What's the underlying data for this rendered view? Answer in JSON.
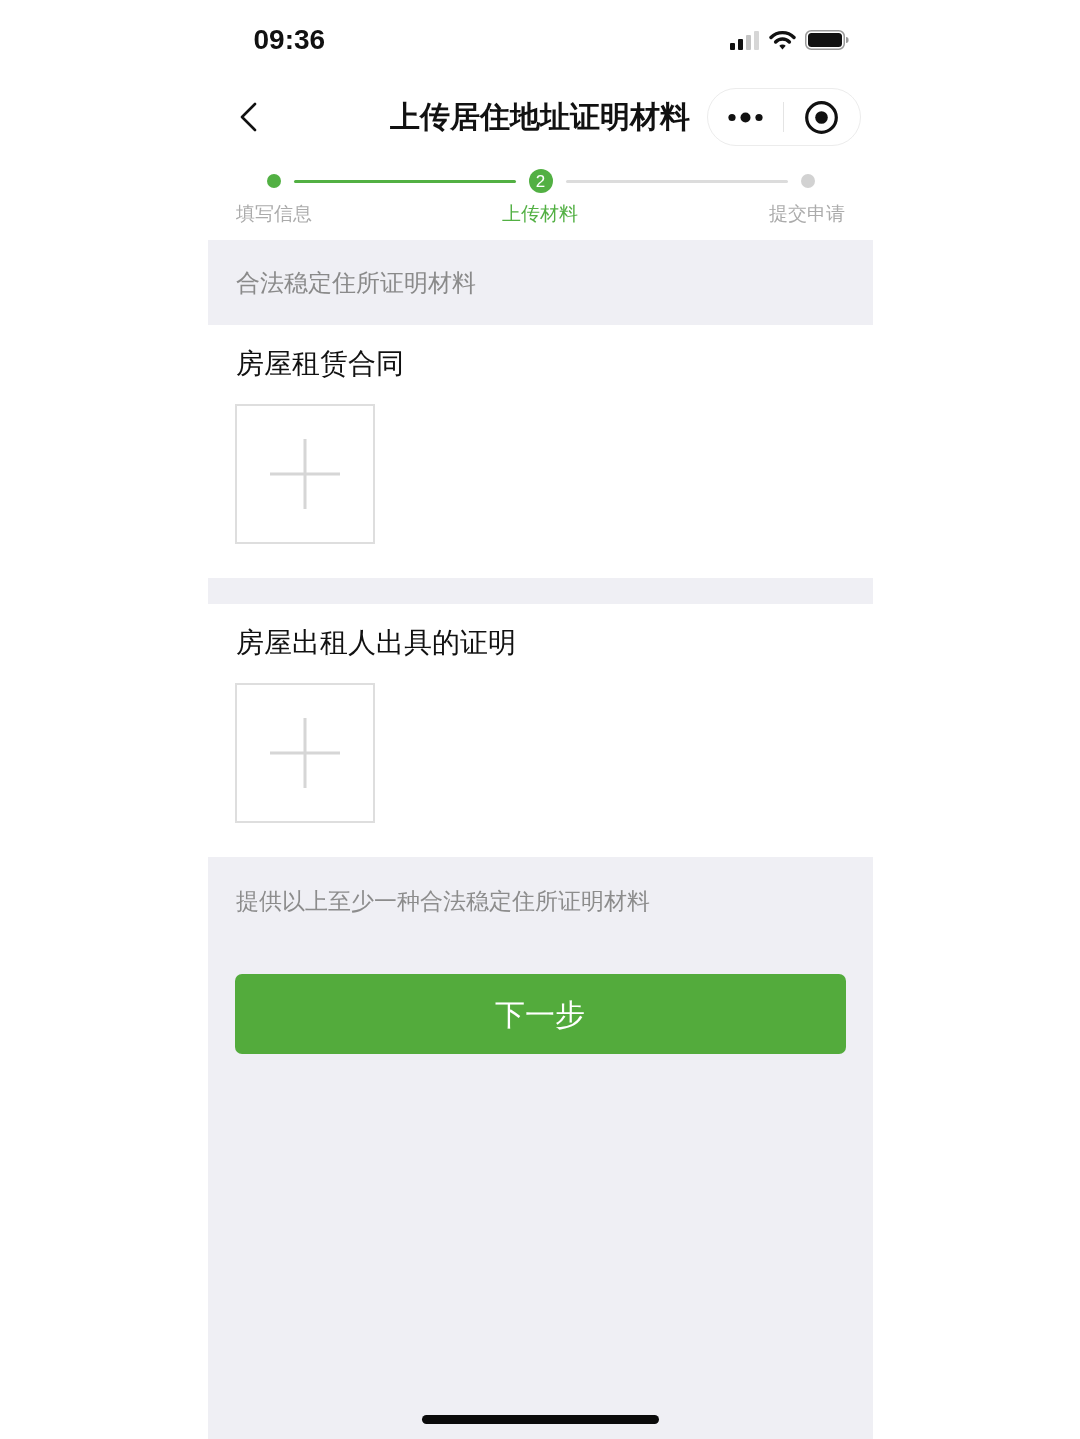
{
  "status_bar": {
    "time": "09:36"
  },
  "nav": {
    "title": "上传居住地址证明材料"
  },
  "steps": [
    {
      "label": "填写信息",
      "done": true,
      "selected": false
    },
    {
      "label": "上传材料",
      "done": true,
      "selected": true,
      "number": "2"
    },
    {
      "label": "提交申请",
      "done": false,
      "selected": false
    }
  ],
  "section": {
    "heading": "合法稳定住所证明材料"
  },
  "uploads": [
    {
      "title": "房屋租赁合同"
    },
    {
      "title": "房屋出租人出具的证明"
    }
  ],
  "hint": "提供以上至少一种合法稳定住所证明材料",
  "next_button": {
    "label": "下一步"
  }
}
